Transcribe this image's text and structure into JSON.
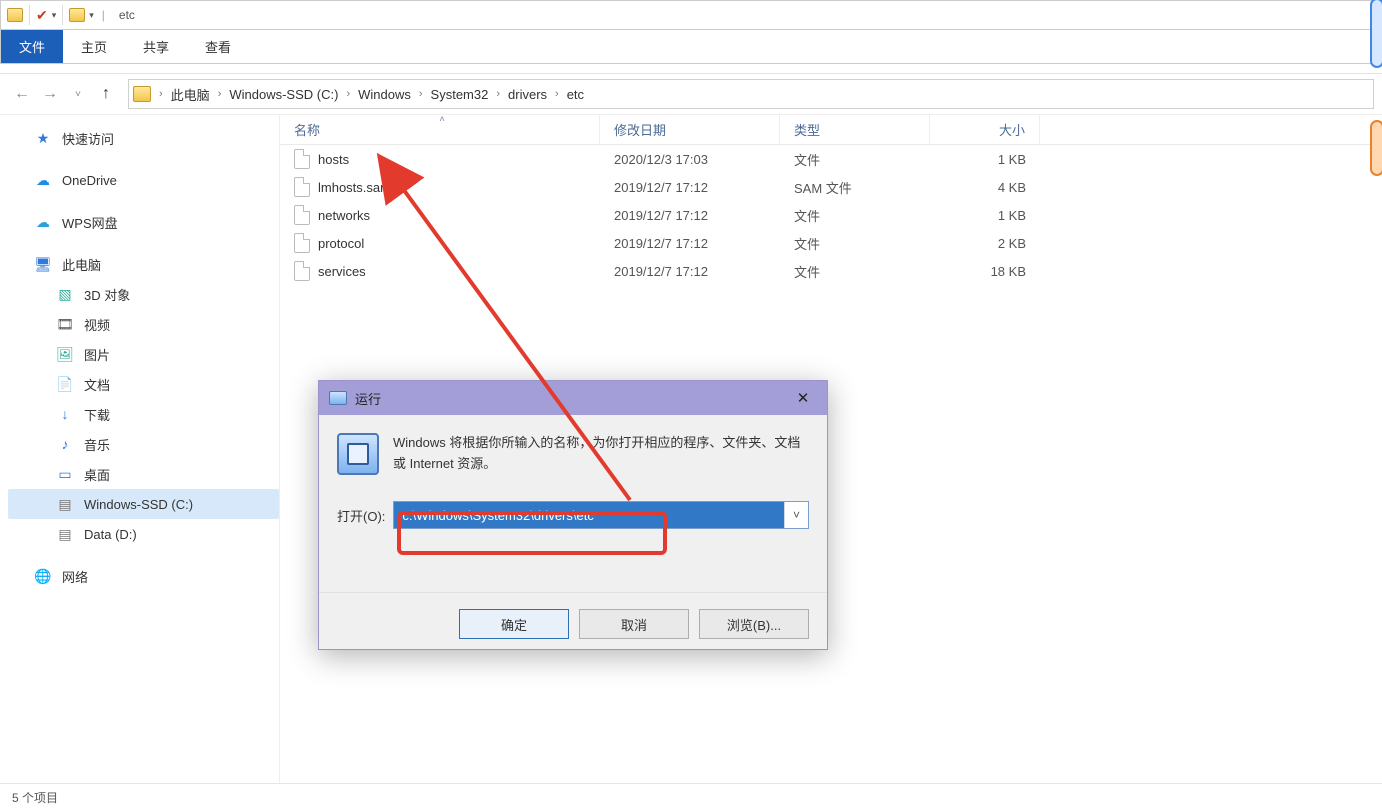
{
  "titlebar": {
    "separator": "|",
    "title": "etc"
  },
  "ribbon": {
    "file": "文件",
    "home": "主页",
    "share": "共享",
    "view": "查看"
  },
  "breadcrumb": [
    "此电脑",
    "Windows-SSD (C:)",
    "Windows",
    "System32",
    "drivers",
    "etc"
  ],
  "columns": {
    "name": "名称",
    "date": "修改日期",
    "type": "类型",
    "size": "大小"
  },
  "files": [
    {
      "name": "hosts",
      "date": "2020/12/3 17:03",
      "type": "文件",
      "size": "1 KB"
    },
    {
      "name": "lmhosts.sam",
      "date": "2019/12/7 17:12",
      "type": "SAM 文件",
      "size": "4 KB"
    },
    {
      "name": "networks",
      "date": "2019/12/7 17:12",
      "type": "文件",
      "size": "1 KB"
    },
    {
      "name": "protocol",
      "date": "2019/12/7 17:12",
      "type": "文件",
      "size": "2 KB"
    },
    {
      "name": "services",
      "date": "2019/12/7 17:12",
      "type": "文件",
      "size": "18 KB"
    }
  ],
  "sidebar": {
    "quick_access": "快速访问",
    "onedrive": "OneDrive",
    "wps": "WPS网盘",
    "this_pc": "此电脑",
    "this_pc_children": [
      "3D 对象",
      "视频",
      "图片",
      "文档",
      "下载",
      "音乐",
      "桌面",
      "Windows-SSD (C:)",
      "Data (D:)"
    ],
    "network": "网络"
  },
  "status": {
    "items": "5 个项目"
  },
  "run_dialog": {
    "title": "运行",
    "description": "Windows 将根据你所输入的名称，为你打开相应的程序、文件夹、文档或 Internet 资源。",
    "open_label": "打开(O):",
    "path": "c:\\Windows\\System32\\drivers\\etc",
    "ok": "确定",
    "cancel": "取消",
    "browse": "浏览(B)..."
  },
  "icons": {
    "quick_access": "★",
    "onedrive": "☁",
    "wps": "☁",
    "this_pc": "🖥",
    "network": "🌐",
    "3d": "▧",
    "video": "🎞",
    "pic": "🖼",
    "doc": "📄",
    "download": "↓",
    "music": "♪",
    "desktop": "▭",
    "drive": "▤"
  }
}
